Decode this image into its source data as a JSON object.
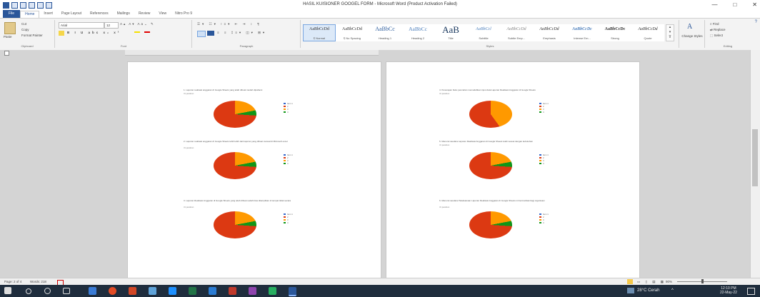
{
  "window": {
    "title": "HASIL KUISIONER GOOGEL FORM  -  Microsoft Word (Product Activation Failed)",
    "controls": [
      "—",
      "□",
      "✕"
    ]
  },
  "tabs": [
    "File",
    "Home",
    "Insert",
    "Page Layout",
    "References",
    "Mailings",
    "Review",
    "View",
    "Nitro Pro 9"
  ],
  "ribbon": {
    "clipboard": {
      "paste": "Paste",
      "cut": "Cut",
      "copy": "Copy",
      "format_painter": "Format Painter",
      "label": "Clipboard"
    },
    "font": {
      "name": "Arial",
      "size": "12",
      "label": "Font"
    },
    "paragraph": {
      "label": "Paragraph"
    },
    "styles": {
      "label": "Styles",
      "items": [
        {
          "preview": "AaBbCcDd",
          "name": "¶ Normal"
        },
        {
          "preview": "AaBbCcDd",
          "name": "¶ No Spacing"
        },
        {
          "preview": "AaBbCc",
          "name": "Heading 1"
        },
        {
          "preview": "AaBbCc",
          "name": "Heading 2"
        },
        {
          "preview": "AaB",
          "name": "Title"
        },
        {
          "preview": "AaBbCcl",
          "name": "Subtitle"
        },
        {
          "preview": "AaBbCcDd",
          "name": "Subtle Emp..."
        },
        {
          "preview": "AaBbCcDd",
          "name": "Emphasis"
        },
        {
          "preview": "AaBbCcDc",
          "name": "Intense Em..."
        },
        {
          "preview": "AaBbCcDc",
          "name": "Strong"
        },
        {
          "preview": "AaBbCcDd",
          "name": "Quote"
        }
      ],
      "change_styles": "Change Styles"
    },
    "editing": {
      "find": "Find",
      "replace": "Replace",
      "select": "Select",
      "label": "Editing"
    }
  },
  "page_left": {
    "questions": [
      {
        "text": "1. Laporan realisasi anggaran di Google Sheets yang telah dibuat mudah dipahami",
        "responses": "31 jawaban"
      },
      {
        "text": "2. Laporan realisasi anggaran di Google Sheets lebih lebih dari laporan yang dibuat manual di Microsoft excel",
        "responses": "31 jawaban"
      },
      {
        "text": "3. Laporan Realisasi Anggaran di Google Sheets yang telah dibuat sudah bisa ditampilkan di tempat tidak secara",
        "responses": "31 jawaban"
      }
    ]
  },
  "page_right": {
    "questions": [
      {
        "text": "4. Penerapan buku pencarian memudahkan input data Laporan Realisasi Anggaran di Google Sheets",
        "responses": "31 jawaban"
      },
      {
        "text": "5. Menurut saudara Laporan Realisasi Anggaran di Google Sheets telah sesuai dengan kebutuhan",
        "responses": "31 jawaban"
      },
      {
        "text": "6. Menurut saudara Pelaksanaan Laporan Realisasi Anggaran di Google Sheets ini bermanfaat bagi organisasi",
        "responses": "31 jawaban"
      }
    ]
  },
  "legend": [
    {
      "label": "Item 1",
      "color": "#3366cc"
    },
    {
      "label": "2",
      "color": "#dc3912"
    },
    {
      "label": "3",
      "color": "#ff9900"
    },
    {
      "label": "4",
      "color": "#109618"
    }
  ],
  "status": {
    "page": "Page: 2 of 4",
    "words": "Words: 218",
    "zoom": "90%"
  },
  "taskbar": {
    "weather": "28°C  Cerah",
    "time": "12:10 PM",
    "date": "22-May-22"
  }
}
